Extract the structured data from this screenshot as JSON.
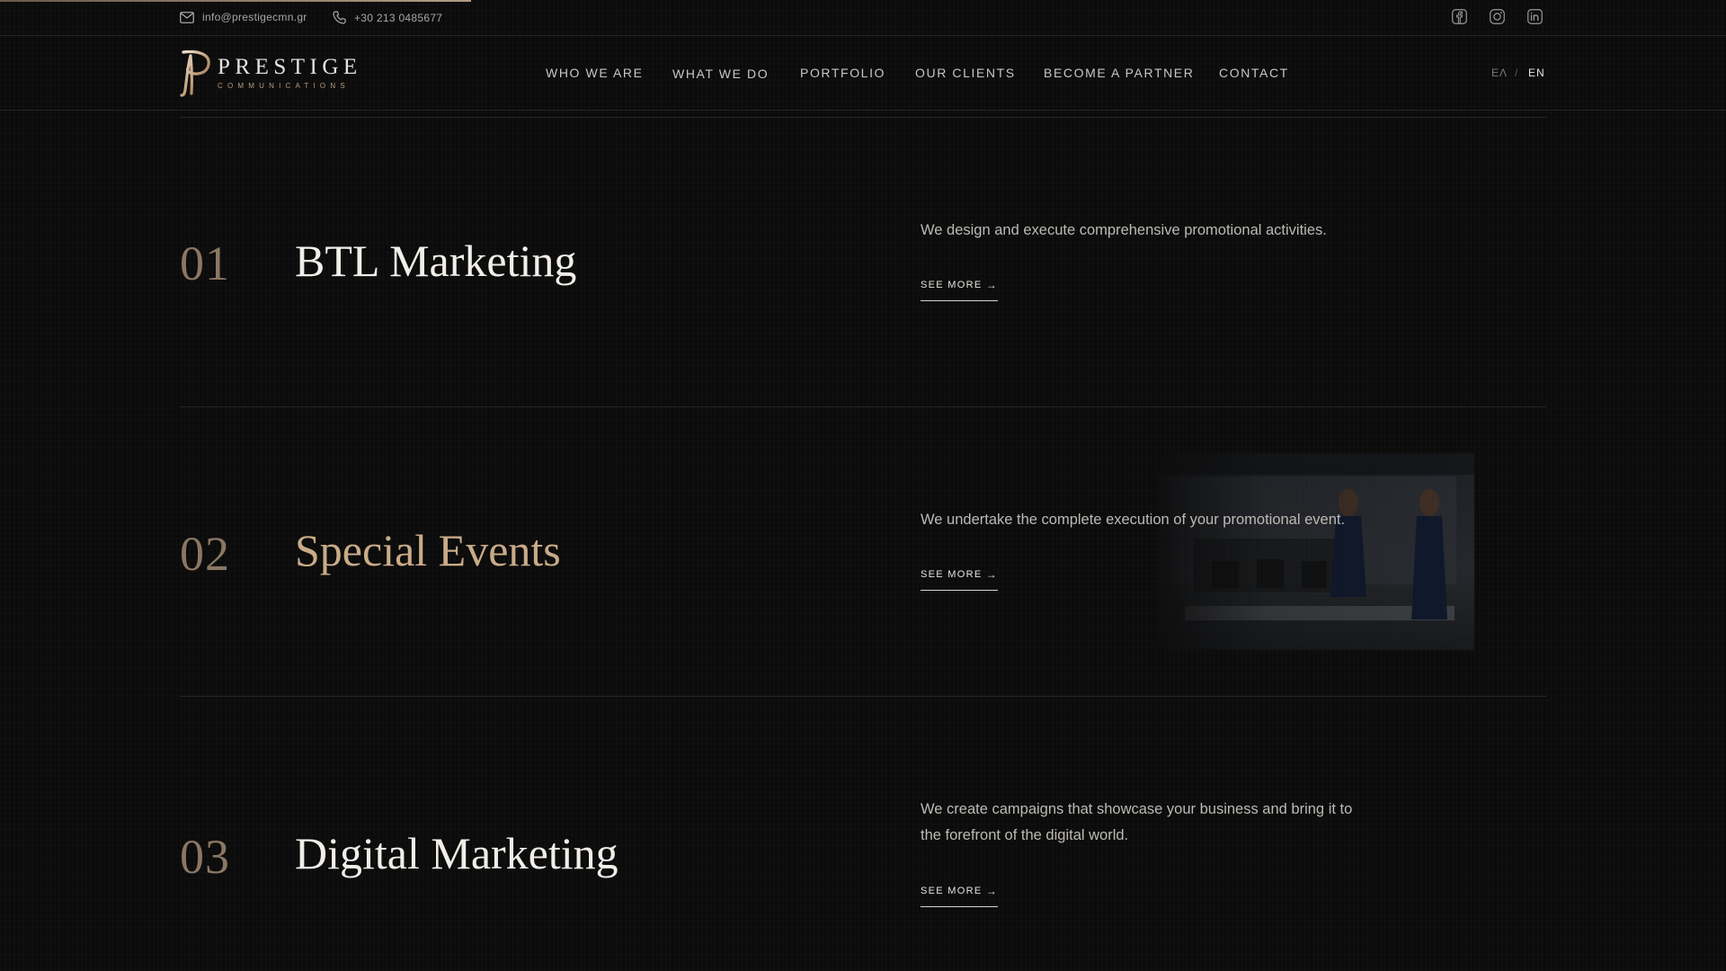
{
  "topbar": {
    "email": "info@prestigecmn.gr",
    "phone": "+30 213 0485677",
    "social_icons": [
      "facebook-icon",
      "instagram-icon",
      "linkedin-icon"
    ]
  },
  "logo": {
    "name": "PRESTIGE",
    "subtitle": "COMMUNICATIONS"
  },
  "nav": {
    "items": [
      {
        "label": "WHO WE ARE"
      },
      {
        "label": "WHAT WE DO"
      },
      {
        "label": "PORTFOLIO"
      },
      {
        "label": "OUR CLIENTS"
      },
      {
        "label": "BECOME A PARTNER"
      },
      {
        "label": "CONTACT"
      }
    ]
  },
  "language": {
    "el": "ΕΛ",
    "separator": "/",
    "en": "EN",
    "active": "EN"
  },
  "services": [
    {
      "number": "01",
      "title": "BTL Marketing",
      "description": "We design and execute comprehensive promotional activities.",
      "link_label": "SEE MORE"
    },
    {
      "number": "02",
      "title": "Special Events",
      "description": "We undertake the complete execution of your promotional event.",
      "link_label": "SEE MORE",
      "highlighted": true
    },
    {
      "number": "03",
      "title": "Digital Marketing",
      "description": "We create campaigns that showcase your business and bring it to the forefront of the digital world.",
      "link_label": "SEE MORE"
    }
  ],
  "colors": {
    "background": "#0b0b0b",
    "accent_gold": "#c9ab88",
    "number_gold": "#8a7763",
    "text_light": "#f1eee9",
    "divider": "#262626"
  }
}
